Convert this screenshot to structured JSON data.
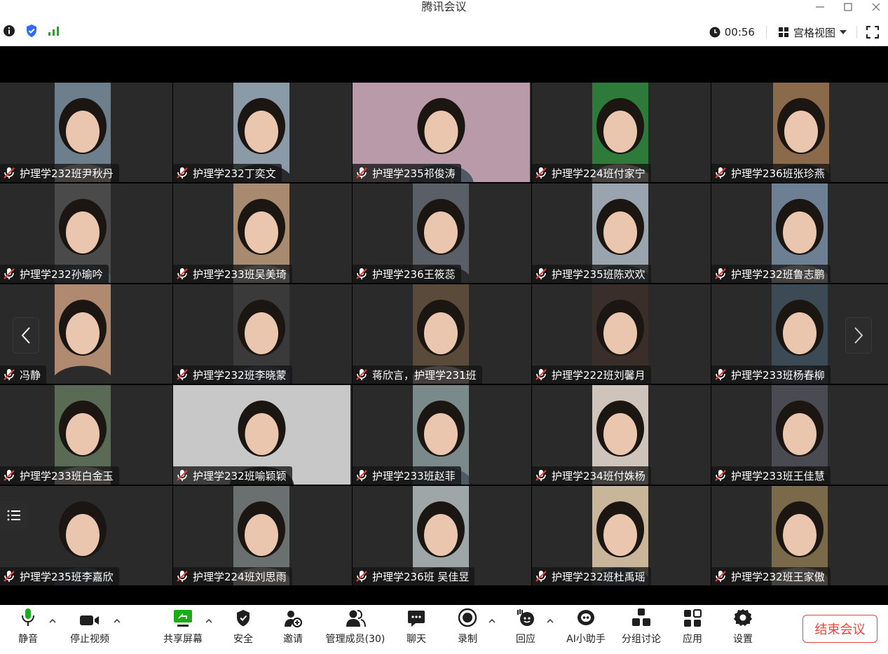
{
  "window": {
    "title": "腾讯会议"
  },
  "infobar": {
    "timer": "00:56",
    "view_label": "宫格视图"
  },
  "colors": {
    "accent": "#1aad19",
    "shield": "#2f6bff",
    "end_red": "#e8453c",
    "share_green": "#1aad19",
    "muted_red": "#e0443a"
  },
  "participants": [
    {
      "name": "护理学232班尹秋丹"
    },
    {
      "name": "护理学232丁奕文"
    },
    {
      "name": "护理学235祁俊涛"
    },
    {
      "name": "护理学224班付家宁"
    },
    {
      "name": "护理学236班张珍燕"
    },
    {
      "name": "护理学232孙瑜吟"
    },
    {
      "name": "护理学233班吴美琦"
    },
    {
      "name": "护理学236王筱蕊"
    },
    {
      "name": "护理学235班陈欢欢"
    },
    {
      "name": "护理学232班鲁志鹏"
    },
    {
      "name": "冯静"
    },
    {
      "name": "护理学232班李晓蒙"
    },
    {
      "name": "蒋欣言，护理学231班"
    },
    {
      "name": "护理学222班刘馨月"
    },
    {
      "name": "护理学233班杨春柳"
    },
    {
      "name": "护理学233班白金玉"
    },
    {
      "name": "护理学232班喻颖颖"
    },
    {
      "name": "护理学233班赵菲"
    },
    {
      "name": "护理学234班付姝杨"
    },
    {
      "name": "护理学233班王佳慧"
    },
    {
      "name": "护理学235班李嘉欣"
    },
    {
      "name": "护理学224班刘思雨"
    },
    {
      "name": "护理学236班 吴佳昱"
    },
    {
      "name": "护理学232班杜禹瑶"
    },
    {
      "name": "护理学232班王家傲"
    }
  ],
  "toolbar": {
    "mute": "静音",
    "stop_video": "停止视频",
    "share": "共享屏幕",
    "security": "安全",
    "invite": "邀请",
    "members": "管理成员(30)",
    "chat": "聊天",
    "record": "录制",
    "react": "回应",
    "ai": "AI小助手",
    "breakout": "分组讨论",
    "apps": "应用",
    "settings": "设置",
    "end": "结束会议"
  }
}
